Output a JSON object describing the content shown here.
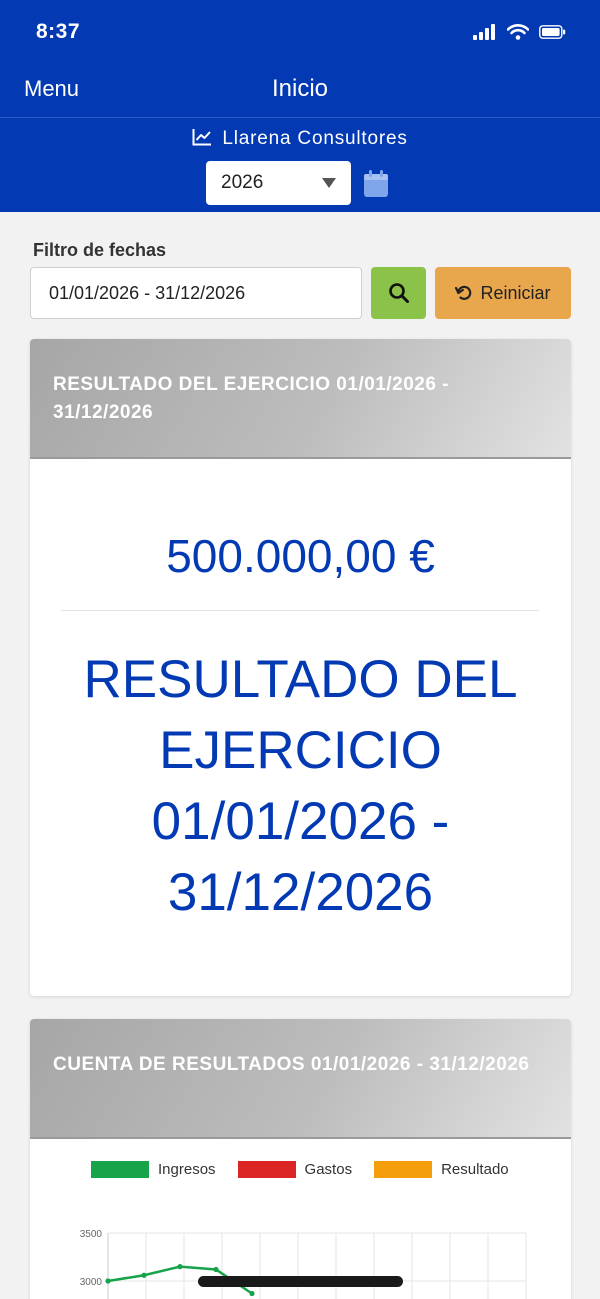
{
  "status_bar": {
    "time": "8:37"
  },
  "nav": {
    "menu_label": "Menu",
    "title": "Inicio"
  },
  "company": {
    "name": "Llarena Consultores",
    "icon": "line-chart-icon"
  },
  "year_select": {
    "value": "2026"
  },
  "filter": {
    "label": "Filtro de fechas",
    "date_range": "01/01/2026 - 31/12/2026",
    "reset_label": "Reiniciar"
  },
  "result_card": {
    "header": "RESULTADO DEL EJERCICIO 01/01/2026 - 31/12/2026",
    "amount": "500.000,00 €",
    "title": "RESULTADO DEL EJERCICIO 01/01/2026 - 31/12/2026"
  },
  "accounts_card": {
    "header": "CUENTA DE RESULTADOS 01/01/2026 - 31/12/2026"
  },
  "colors": {
    "brand_blue": "#0339b3",
    "search_green": "#8bc34a",
    "reset_orange": "#e8a64d",
    "ingresos": "#17a34a",
    "gastos": "#dc2626",
    "resultado": "#f59e0b"
  },
  "chart_data": {
    "type": "line",
    "title": "",
    "legend_position": "top",
    "grid": true,
    "series": [
      {
        "name": "Ingresos",
        "color": "#17a34a",
        "values": [
          3000,
          3060,
          3150,
          3120,
          2870
        ]
      },
      {
        "name": "Gastos",
        "color": "#dc2626",
        "values": []
      },
      {
        "name": "Resultado",
        "color": "#f59e0b",
        "values": []
      }
    ],
    "y_ticks": [
      "3500",
      "3000"
    ],
    "ylim_visible": [
      2800,
      3500
    ]
  }
}
